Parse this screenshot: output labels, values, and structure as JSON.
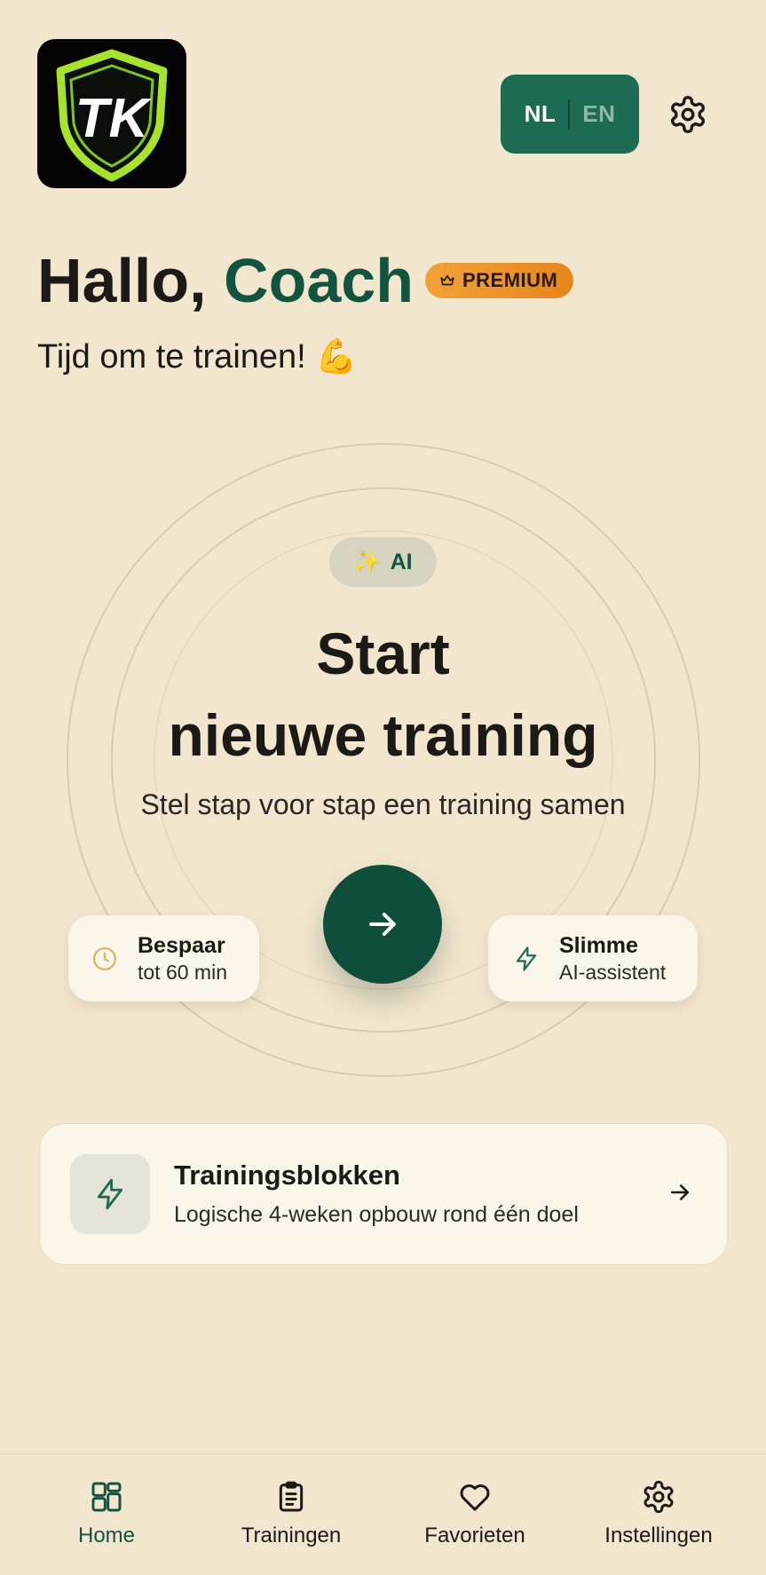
{
  "header": {
    "logo_text": "TK",
    "lang_nl": "NL",
    "lang_en": "EN"
  },
  "greeting": {
    "hello": "Hallo,",
    "name": "Coach",
    "badge": "PREMIUM",
    "subtitle": "Tijd om te trainen! 💪"
  },
  "hero": {
    "ai_badge": "AI",
    "ai_emoji": "✨",
    "title_line1": "Start",
    "title_line2": "nieuwe training",
    "subtitle": "Stel stap voor stap een training samen",
    "left_pill": {
      "title": "Bespaar",
      "subtitle": "tot 60 min"
    },
    "right_pill": {
      "title": "Slimme",
      "subtitle": "AI-assistent"
    }
  },
  "card": {
    "title": "Trainingsblokken",
    "subtitle": "Logische 4-weken opbouw rond één doel"
  },
  "nav": {
    "items": [
      {
        "label": "Home",
        "icon": "grid-icon",
        "active": true
      },
      {
        "label": "Trainingen",
        "icon": "clipboard-icon",
        "active": false
      },
      {
        "label": "Favorieten",
        "icon": "heart-icon",
        "active": false
      },
      {
        "label": "Instellingen",
        "icon": "gear-icon",
        "active": false
      }
    ]
  },
  "colors": {
    "background": "#f3e6cf",
    "primary": "#0f4e3b",
    "premium": "#ee951f"
  }
}
